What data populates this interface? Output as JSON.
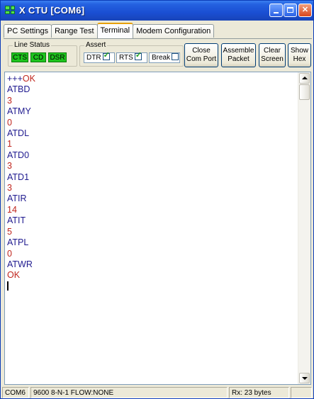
{
  "window": {
    "title": "X CTU  [COM6]"
  },
  "tabs": [
    {
      "label": "PC Settings",
      "active": false
    },
    {
      "label": "Range Test",
      "active": false
    },
    {
      "label": "Terminal",
      "active": true
    },
    {
      "label": "Modem Configuration",
      "active": false
    }
  ],
  "line_status": {
    "legend": "Line Status",
    "leds": [
      {
        "label": "CTS",
        "color": "#1ec41e"
      },
      {
        "label": "CD",
        "color": "#1ec41e"
      },
      {
        "label": "DSR",
        "color": "#1ec41e"
      }
    ]
  },
  "assert": {
    "legend": "Assert",
    "checkboxes": [
      {
        "label": "DTR",
        "checked": true
      },
      {
        "label": "RTS",
        "checked": true
      },
      {
        "label": "Break",
        "checked": false
      }
    ]
  },
  "buttons": {
    "close_com_port": "Close\nCom Port",
    "assemble_packet": "Assemble\nPacket",
    "clear_screen": "Clear\nScreen",
    "show_hex": "Show\nHex"
  },
  "terminal": {
    "colors": {
      "sent": "#1f1a8f",
      "received": "#c0261e"
    },
    "lines": [
      [
        {
          "text": "+++",
          "kind": "sent"
        },
        {
          "text": "OK",
          "kind": "received"
        }
      ],
      [
        {
          "text": "ATBD",
          "kind": "sent"
        }
      ],
      [
        {
          "text": "3",
          "kind": "received"
        }
      ],
      [
        {
          "text": "ATMY",
          "kind": "sent"
        }
      ],
      [
        {
          "text": "0",
          "kind": "received"
        }
      ],
      [
        {
          "text": "ATDL",
          "kind": "sent"
        }
      ],
      [
        {
          "text": "1",
          "kind": "received"
        }
      ],
      [
        {
          "text": "ATD0",
          "kind": "sent"
        }
      ],
      [
        {
          "text": "3",
          "kind": "received"
        }
      ],
      [
        {
          "text": "ATD1",
          "kind": "sent"
        }
      ],
      [
        {
          "text": "3",
          "kind": "received"
        }
      ],
      [
        {
          "text": "ATIR",
          "kind": "sent"
        }
      ],
      [
        {
          "text": "14",
          "kind": "received"
        }
      ],
      [
        {
          "text": "ATIT",
          "kind": "sent"
        }
      ],
      [
        {
          "text": "5",
          "kind": "received"
        }
      ],
      [
        {
          "text": "ATPL",
          "kind": "sent"
        }
      ],
      [
        {
          "text": "0",
          "kind": "received"
        }
      ],
      [
        {
          "text": "ATWR",
          "kind": "sent"
        }
      ],
      [
        {
          "text": "OK",
          "kind": "received"
        }
      ]
    ]
  },
  "statusbar": {
    "port": "COM6",
    "settings": "9600 8-N-1  FLOW:NONE",
    "rx": "Rx: 23 bytes"
  }
}
